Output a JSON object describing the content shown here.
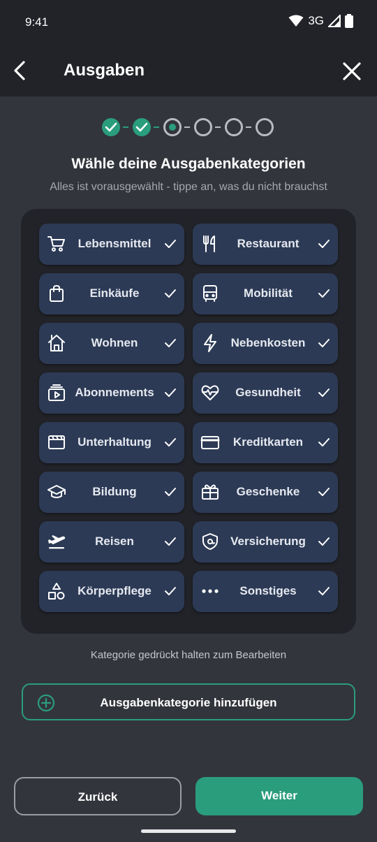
{
  "status_bar": {
    "time": "9:41",
    "network": "3G"
  },
  "app_bar": {
    "title": "Ausgaben",
    "back_icon": "arrow-back-icon",
    "close_icon": "close-icon"
  },
  "stepper": {
    "total_steps": 6,
    "completed_steps": 2,
    "current_step": 3
  },
  "heading": "Wähle deine Ausgabenkategorien",
  "subheading": "Alles ist vorausgewählt - tippe an, was du nicht brauchst",
  "categories": [
    {
      "label": "Lebensmittel",
      "icon": "shopping-cart-icon",
      "selected": true
    },
    {
      "label": "Restaurant",
      "icon": "cutlery-icon",
      "selected": true
    },
    {
      "label": "Einkäufe",
      "icon": "shopping-bag-icon",
      "selected": true
    },
    {
      "label": "Mobilität",
      "icon": "bus-icon",
      "selected": true
    },
    {
      "label": "Wohnen",
      "icon": "house-icon",
      "selected": true
    },
    {
      "label": "Nebenkosten",
      "icon": "lightning-icon",
      "selected": true
    },
    {
      "label": "Abonnements",
      "icon": "subscriptions-icon",
      "selected": true
    },
    {
      "label": "Gesundheit",
      "icon": "heart-pulse-icon",
      "selected": true
    },
    {
      "label": "Unterhaltung",
      "icon": "clapperboard-icon",
      "selected": true
    },
    {
      "label": "Kreditkarten",
      "icon": "credit-card-icon",
      "selected": true
    },
    {
      "label": "Bildung",
      "icon": "graduation-cap-icon",
      "selected": true
    },
    {
      "label": "Geschenke",
      "icon": "gift-icon",
      "selected": true
    },
    {
      "label": "Reisen",
      "icon": "airplane-takeoff-icon",
      "selected": true
    },
    {
      "label": "Versicherung",
      "icon": "shield-icon",
      "selected": true
    },
    {
      "label": "Körperpflege",
      "icon": "shapes-icon",
      "selected": true
    },
    {
      "label": "Sonstiges",
      "icon": "more-dots-icon",
      "selected": true
    }
  ],
  "hint": "Kategorie gedrückt halten zum Bearbeiten",
  "add_button_label": "Ausgabenkategorie hinzufügen",
  "back_button_label": "Zurück",
  "next_button_label": "Weiter",
  "colors": {
    "background": "#33353c",
    "bar": "#212328",
    "chip": "#2c3a55",
    "accent": "#2a9d7c",
    "muted_text": "#a6a8ad"
  }
}
